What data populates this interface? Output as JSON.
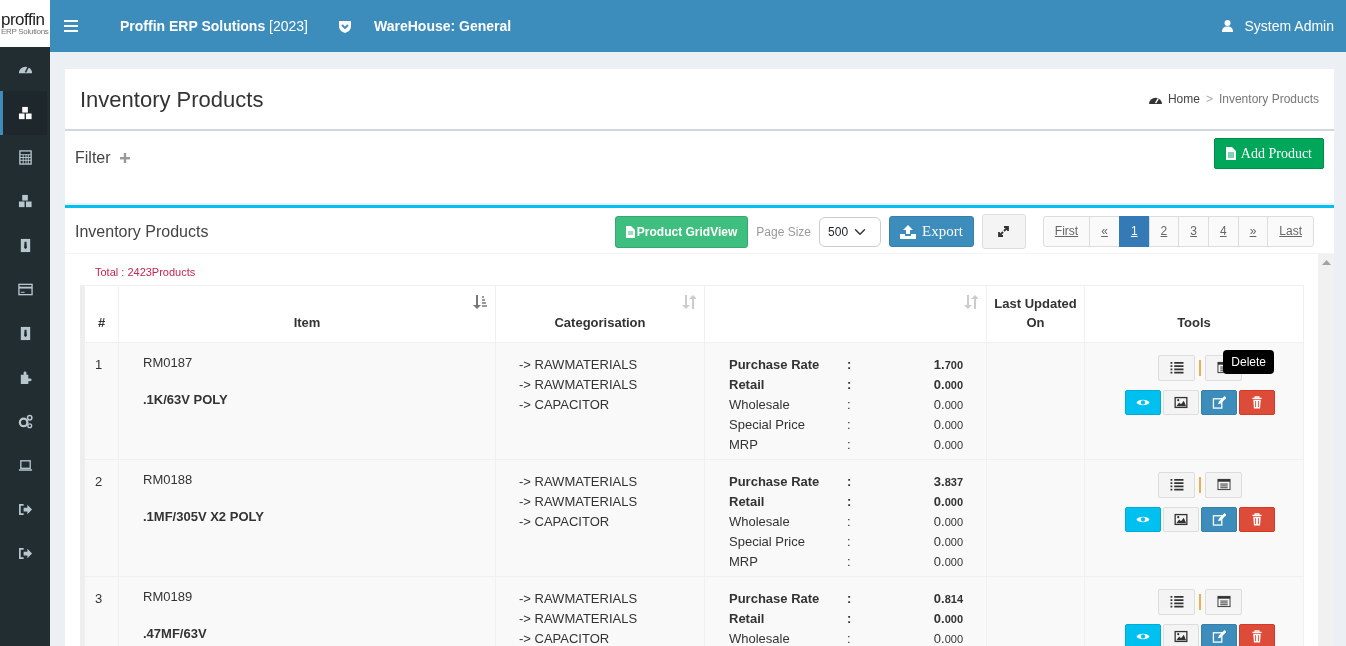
{
  "logo": {
    "text": "proffin",
    "subtitle": "ERP Solutions"
  },
  "topbar": {
    "title": "Proffin ERP Solutions",
    "year": "[2023]",
    "warehouse": "WareHouse: General",
    "user": "System Admin"
  },
  "sidebar": {
    "items": [
      {
        "kind": "gauge",
        "selected": false
      },
      {
        "kind": "cubes",
        "selected": true
      },
      {
        "kind": "calculator",
        "selected": false
      },
      {
        "kind": "cubes",
        "selected": false
      },
      {
        "kind": "badge",
        "selected": false
      },
      {
        "kind": "card",
        "selected": false
      },
      {
        "kind": "badge",
        "selected": false
      },
      {
        "kind": "puzzle",
        "selected": false
      },
      {
        "kind": "gears",
        "selected": false
      },
      {
        "kind": "laptop",
        "selected": false
      },
      {
        "kind": "signout",
        "selected": false
      },
      {
        "kind": "signout",
        "selected": false
      }
    ]
  },
  "page": {
    "title": "Inventory Products",
    "breadcrumb": [
      {
        "label": "Home"
      },
      {
        "label": "Inventory Products"
      }
    ],
    "separator": ">"
  },
  "filter": {
    "label": "Filter",
    "expanded": false,
    "add_button": "Add Product"
  },
  "panel": {
    "title": "Inventory Products",
    "gridview_button": "Product GridView",
    "page_size_label": "Page Size",
    "page_size": "500",
    "export_button": "Export",
    "pagination": [
      {
        "label": "First",
        "selected": false
      },
      {
        "label": "«",
        "selected": false
      },
      {
        "label": "1",
        "selected": true
      },
      {
        "label": "2",
        "selected": false
      },
      {
        "label": "3",
        "selected": false
      },
      {
        "label": "4",
        "selected": false
      },
      {
        "label": "»",
        "selected": false
      },
      {
        "label": "Last",
        "selected": false
      }
    ],
    "total": "Total : 2423Products"
  },
  "table": {
    "columns": [
      {
        "label": "#"
      },
      {
        "label": "Item",
        "sorted": true
      },
      {
        "label": "Categorisation",
        "sorted": false
      },
      {
        "sorted": false
      },
      {
        "label": "Last Updated On"
      },
      {
        "label": "Tools"
      }
    ],
    "rows": [
      {
        "number": "1",
        "code": "RM0187",
        "name": ".1K/63V POLY",
        "categories": [
          "-> RAWMATERIALS",
          "-> RAWMATERIALS",
          "-> CAPACITOR"
        ],
        "rates": [
          {
            "label": "Purchase Rate",
            "colon": ":",
            "value": "1.700",
            "emphasis": true
          },
          {
            "label": "Retail",
            "colon": ":",
            "value": "0.000",
            "emphasis": true
          },
          {
            "label": "Wholesale",
            "colon": ":",
            "value": "0.000",
            "emphasis": false
          },
          {
            "label": "Special Price",
            "colon": ":",
            "value": "0.000",
            "emphasis": false
          },
          {
            "label": "MRP",
            "colon": ":",
            "value": "0.000",
            "emphasis": false
          }
        ],
        "tooltip": "Delete"
      },
      {
        "number": "2",
        "code": "RM0188",
        "name": ".1MF/305V X2 POLY",
        "categories": [
          "-> RAWMATERIALS",
          "-> RAWMATERIALS",
          "-> CAPACITOR"
        ],
        "rates": [
          {
            "label": "Purchase Rate",
            "colon": ":",
            "value": "3.837",
            "emphasis": true
          },
          {
            "label": "Retail",
            "colon": ":",
            "value": "0.000",
            "emphasis": true
          },
          {
            "label": "Wholesale",
            "colon": ":",
            "value": "0.000",
            "emphasis": false
          },
          {
            "label": "Special Price",
            "colon": ":",
            "value": "0.000",
            "emphasis": false
          },
          {
            "label": "MRP",
            "colon": ":",
            "value": "0.000",
            "emphasis": false
          }
        ]
      },
      {
        "number": "3",
        "code": "RM0189",
        "name": ".47MF/63V",
        "categories": [
          "-> RAWMATERIALS",
          "-> RAWMATERIALS",
          "-> CAPACITOR"
        ],
        "rates": [
          {
            "label": "Purchase Rate",
            "colon": ":",
            "value": "0.814",
            "emphasis": true
          },
          {
            "label": "Retail",
            "colon": ":",
            "value": "0.000",
            "emphasis": true
          },
          {
            "label": "Wholesale",
            "colon": ":",
            "value": "0.000",
            "emphasis": false
          }
        ]
      }
    ]
  }
}
